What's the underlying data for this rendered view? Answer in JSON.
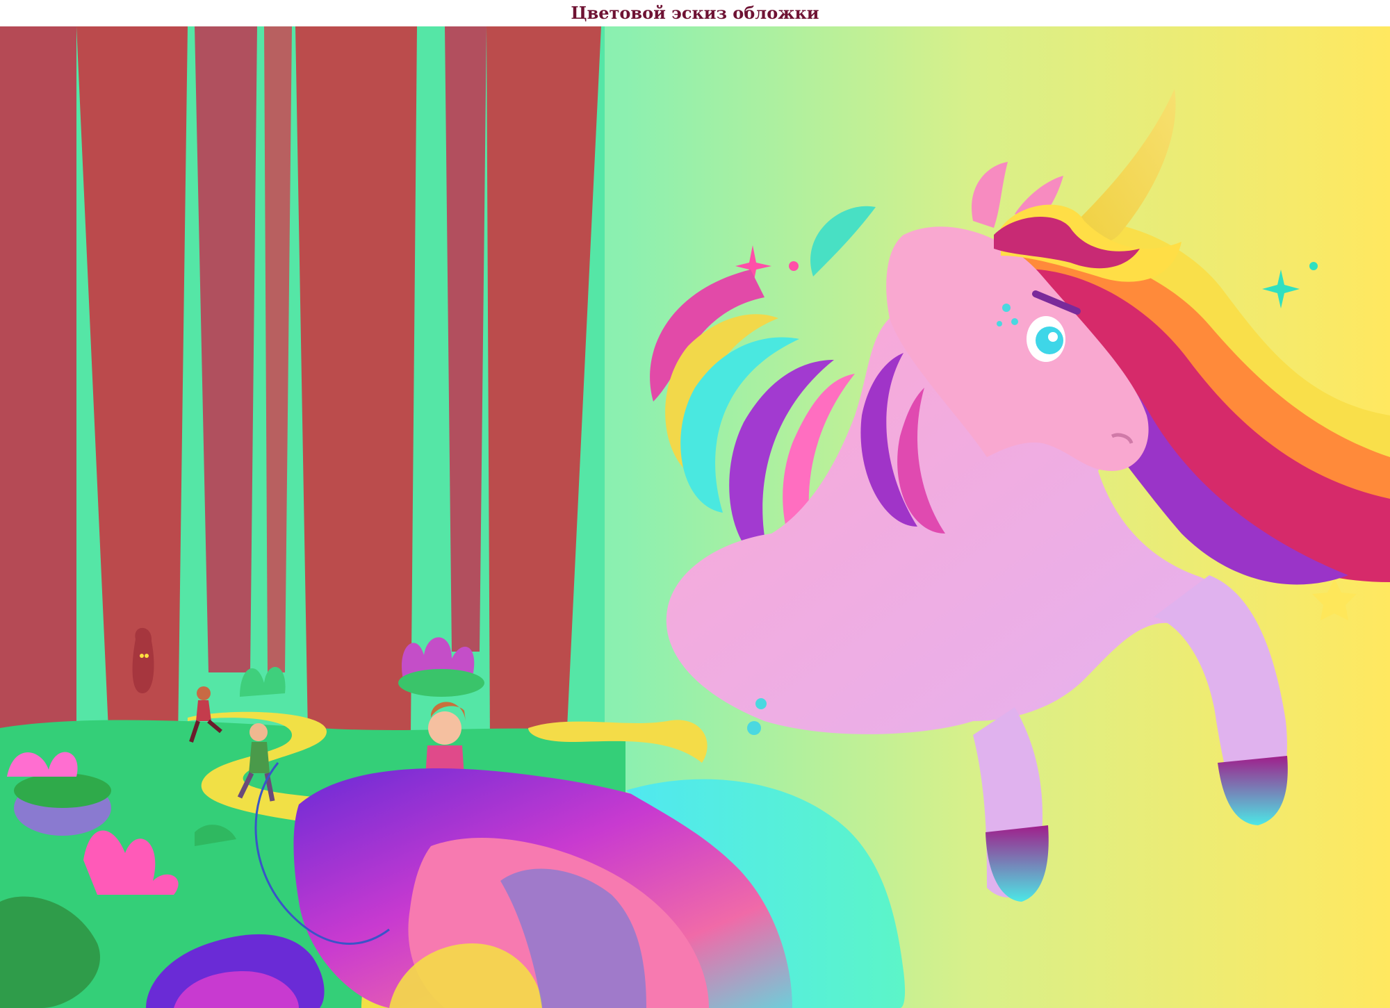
{
  "caption": "Цветовой эскиз обложки",
  "colors": {
    "caption_text": "#6e1233",
    "sky_left": "#5ef0b8",
    "sky_right": "#ffea58",
    "trunk": "#b9484e",
    "ground": "#34d07a",
    "path": "#f2e146",
    "unicorn_body": "#fbaedb",
    "horn": "#f4d94a"
  }
}
